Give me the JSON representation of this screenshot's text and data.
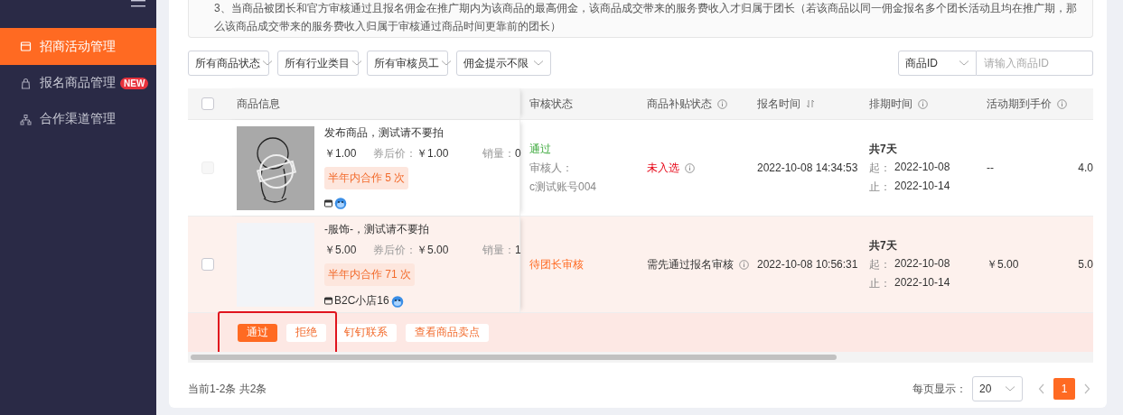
{
  "sidebar": {
    "items": [
      {
        "label": "招商活动管理",
        "selected": true
      },
      {
        "label": "报名商品管理",
        "badge": "NEW",
        "selected": false
      },
      {
        "label": "合作渠道管理",
        "selected": false
      }
    ]
  },
  "notice": "3、当商品被团长和官方审核通过且报名佣金在推广期内为该商品的最高佣金，该商品成交带来的服务费收入才归属于团长（若该商品以同一佣金报名多个团长活动且均在推广期，那么该商品成交带来的服务费收入归属于审核通过商品时间更靠前的团长）",
  "filters": [
    {
      "value": "所有商品状态"
    },
    {
      "value": "所有行业类目"
    },
    {
      "value": "所有审核员工"
    },
    {
      "value": "佣金提示不限"
    }
  ],
  "search": {
    "type": "商品ID",
    "placeholder": "请输入商品ID"
  },
  "table": {
    "select_all": {
      "checked": false
    },
    "columns": [
      {
        "label": "商品信息"
      },
      {
        "label": "审核状态"
      },
      {
        "label": "商品补贴状态",
        "info": true
      },
      {
        "label": "报名时间",
        "sort": true
      },
      {
        "label": "排期时间",
        "info": true
      },
      {
        "label": "活动期到手价",
        "info": true
      }
    ],
    "rows": [
      {
        "checked": false,
        "disabled": true,
        "selected": false,
        "has_image": true,
        "title": "发布商品，测试请不要拍",
        "price": "￥1.00",
        "coupon_label": "券后价：",
        "coupon_price": "￥1.00",
        "sales_label": "销量：",
        "sales": "0",
        "tag": "半年内合作 5 次",
        "status": {
          "text": "通过",
          "kind": "approved"
        },
        "reviewer_label": "审核人：",
        "reviewer": "c测试账号004",
        "subsidy": {
          "text": "未入选",
          "kind": "rejected"
        },
        "time": "2022-10-08 14:34:53",
        "schedule": {
          "total": "共7天",
          "start_label": "起：",
          "start": "2022-10-08",
          "end_label": "止：",
          "end": "2022-10-14"
        },
        "active_price": "--",
        "column_8": "4.0"
      },
      {
        "checked": false,
        "disabled": false,
        "selected": true,
        "has_image": false,
        "title": "-服饰-，测试请不要拍",
        "price": "￥5.00",
        "coupon_label": "券后价：",
        "coupon_price": "￥5.00",
        "sales_label": "销量：",
        "sales": "1",
        "tag": "半年内合作 71 次",
        "shop": "B2C小店16",
        "status": {
          "text": "待团长审核",
          "kind": "pending"
        },
        "subsidy": {
          "text": "需先通过报名审核",
          "kind": "pending"
        },
        "time": "2022-10-08 10:56:31",
        "schedule": {
          "total": "共7天",
          "start_label": "起：",
          "start": "2022-10-08",
          "end_label": "止：",
          "end": "2022-10-14"
        },
        "active_price": "￥5.00",
        "column_8": "5.0",
        "actions": [
          {
            "label": "通过",
            "kind": "primary"
          },
          {
            "label": "拒绝",
            "kind": "default"
          },
          {
            "label": "钉钉联系",
            "kind": "default"
          },
          {
            "label": "查看商品卖点",
            "kind": "default"
          }
        ]
      }
    ]
  },
  "footer": {
    "summary": "当前1-2条 共2条",
    "page_size_label": "每页显示：",
    "page_size": "20",
    "pages": [
      {
        "label": "1",
        "selected": true
      }
    ]
  }
}
